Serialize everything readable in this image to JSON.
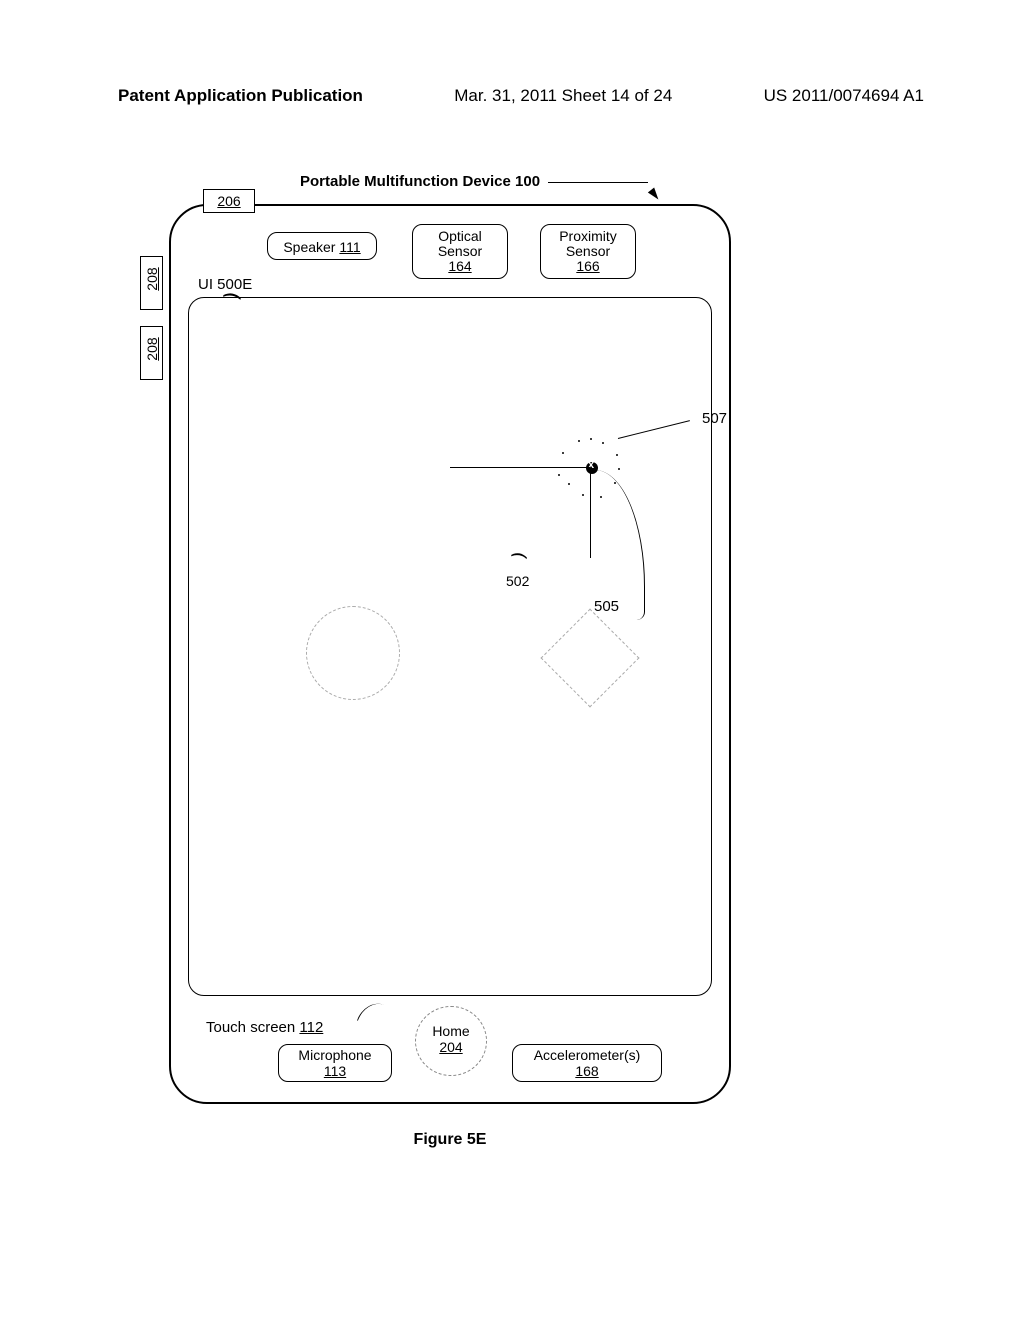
{
  "header": {
    "left": "Patent Application Publication",
    "center": "Mar. 31, 2011  Sheet 14 of 24",
    "right": "US 2011/0074694 A1"
  },
  "title": "Portable Multifunction Device 100",
  "refs": {
    "r206": "206",
    "r208": "208",
    "r507": "507",
    "r502": "502",
    "r505": "505"
  },
  "components": {
    "speaker": {
      "label": "Speaker",
      "num": "111"
    },
    "optical": {
      "label": "Optical Sensor",
      "num": "164"
    },
    "proximity": {
      "label": "Proximity Sensor",
      "num": "166"
    },
    "ui": "UI 500E",
    "touch": {
      "label": "Touch screen",
      "num": "112"
    },
    "home": {
      "label": "Home",
      "num": "204"
    },
    "microphone": {
      "label": "Microphone",
      "num": "113"
    },
    "accelerometer": {
      "label": "Accelerometer(s)",
      "num": "168"
    }
  },
  "caption": "Figure 5E"
}
